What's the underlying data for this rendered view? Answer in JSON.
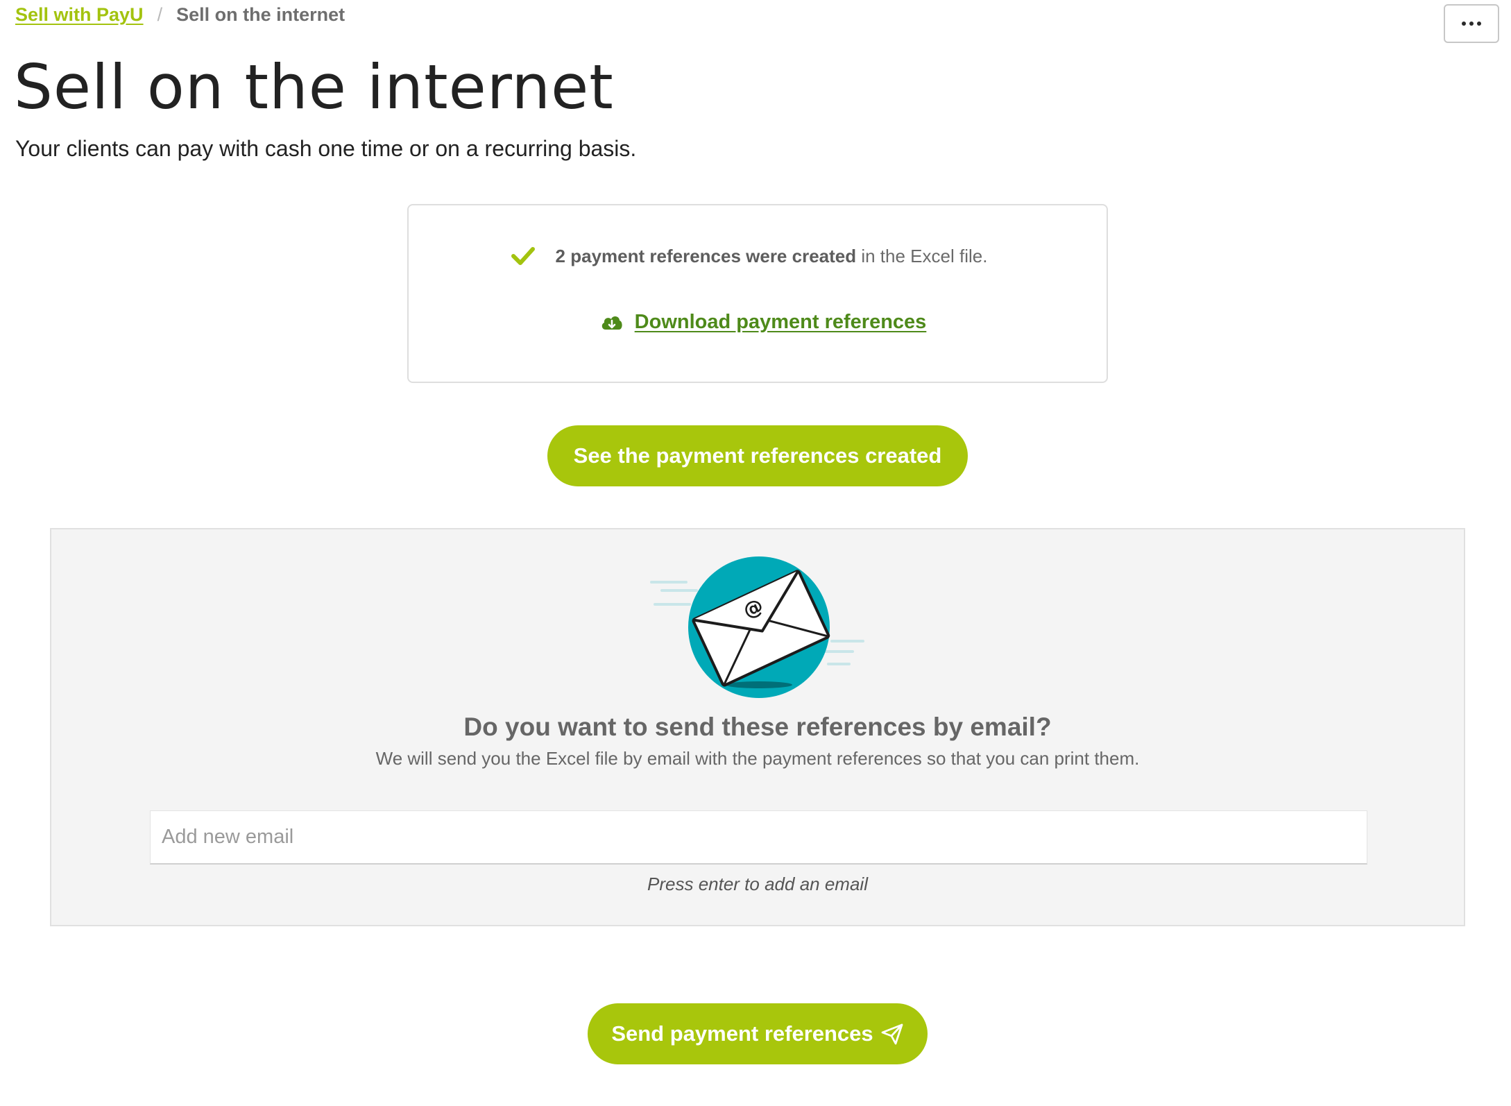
{
  "breadcrumb": {
    "parent": "Sell with PayU",
    "separator": "/",
    "current": "Sell on the internet"
  },
  "header": {
    "title": "Sell on the internet",
    "subtitle": "Your clients can pay with cash one time or on a recurring basis."
  },
  "result": {
    "bold_text": "2 payment references were created",
    "rest_text": " in the Excel file.",
    "download_label": "Download payment references"
  },
  "actions": {
    "see_label": "See the payment references created",
    "send_label": "Send payment references"
  },
  "email_panel": {
    "title": "Do you want to send these references by email?",
    "description": "We will send you the Excel file by email with the payment references so that you can print them.",
    "input_placeholder": "Add new email",
    "input_value": "",
    "hint": "Press enter to add an email"
  },
  "icons": {
    "more": "more-horizontal-icon",
    "check": "check-icon",
    "download": "cloud-download-icon",
    "email": "email-envelope-illustration",
    "send": "paper-plane-icon"
  },
  "colors": {
    "brand_green": "#a8c60c",
    "link_green": "#4e8a1a",
    "breadcrumb_green": "#a3c30f",
    "teal": "#00a9b7",
    "panel_bg": "#f4f4f4"
  }
}
